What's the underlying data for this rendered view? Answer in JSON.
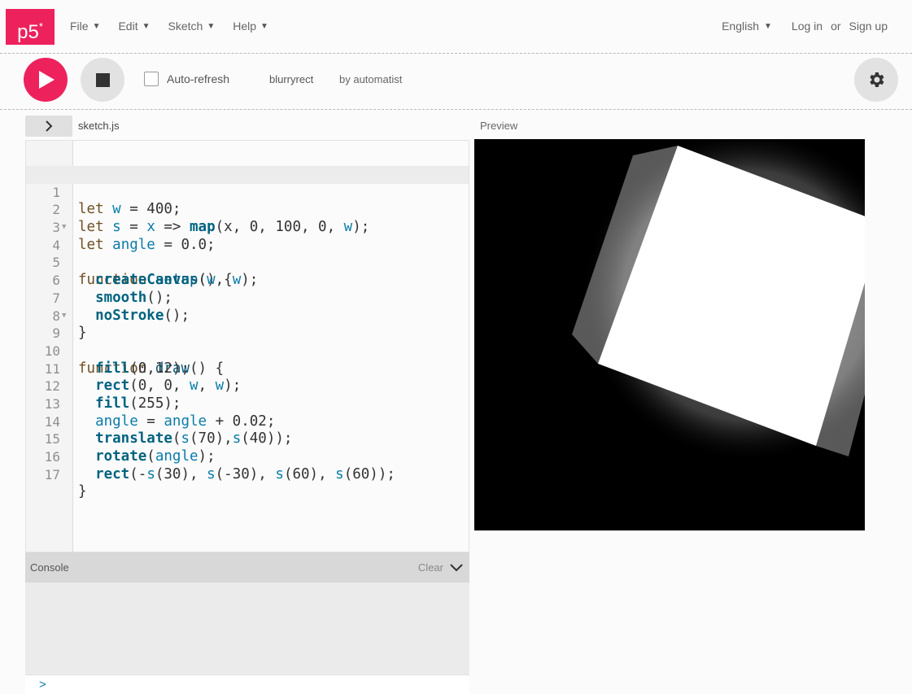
{
  "app": {
    "logo": "p5",
    "logo_mark": "*"
  },
  "nav": {
    "menus": [
      {
        "label": "File"
      },
      {
        "label": "Edit"
      },
      {
        "label": "Sketch"
      },
      {
        "label": "Help"
      }
    ],
    "language": "English",
    "login": "Log in",
    "or": "or",
    "signup": "Sign up"
  },
  "toolbar": {
    "auto_refresh_label": "Auto-refresh",
    "auto_refresh_checked": false,
    "sketch_name": "blurryrect",
    "author": "by automatist"
  },
  "editor": {
    "tab_name": "sketch.js",
    "lines": [
      "let w = 400;",
      "let s = x => map(x, 0, 100, 0, w);",
      "let angle = 0.0;",
      "function setup() {",
      "  createCanvas(w, w);",
      "  smooth();",
      "  noStroke();",
      "}",
      "function draw() {",
      "  fill(0,12);",
      "  rect(0, 0, w, w);",
      "  fill(255);",
      "  angle = angle + 0.02;",
      "  translate(s(70),s(40));",
      "  rotate(angle);",
      "  rect(-s(30), s(-30), s(60), s(60));",
      "}"
    ],
    "line_numbers": [
      "1",
      "2",
      "3",
      "4",
      "5",
      "6",
      "7",
      "8",
      "9",
      "10",
      "11",
      "12",
      "13",
      "14",
      "15",
      "16",
      "17"
    ]
  },
  "preview": {
    "label": "Preview"
  },
  "console": {
    "title": "Console",
    "clear_label": "Clear",
    "prompt": ">"
  },
  "colors": {
    "accent": "#ed225d",
    "canvas": "#000000"
  },
  "icons": {
    "play": "play-icon",
    "stop": "stop-icon",
    "settings": "gear-icon",
    "expand": "chevron-right-icon",
    "collapse_console": "chevron-down-icon"
  }
}
